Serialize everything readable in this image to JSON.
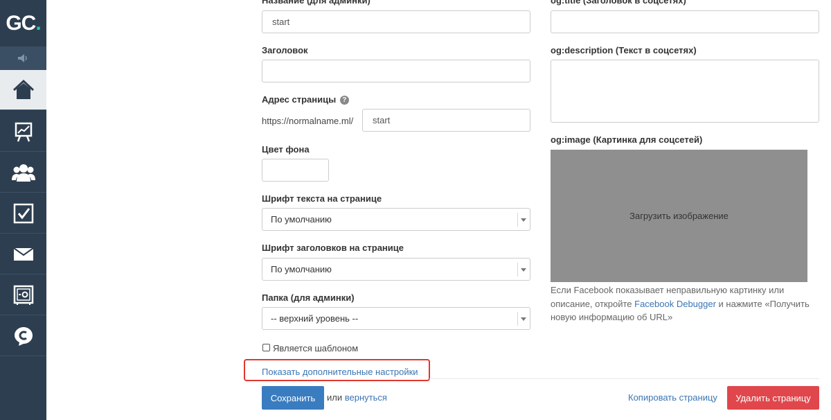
{
  "sidebar": {
    "logo": {
      "text_g": "G",
      "text_c": "C",
      "dot": "."
    },
    "sound_icon": "speaker-icon",
    "items": [
      {
        "name": "home",
        "icon": "home-icon",
        "active": true
      },
      {
        "name": "stats",
        "icon": "chart-easel-icon",
        "active": false
      },
      {
        "name": "users",
        "icon": "users-icon",
        "active": false
      },
      {
        "name": "tasks",
        "icon": "checkbox-icon",
        "active": false
      },
      {
        "name": "mail",
        "icon": "envelope-icon",
        "active": false
      },
      {
        "name": "safe",
        "icon": "safe-icon",
        "active": false
      },
      {
        "name": "chat",
        "icon": "chat-bubble-icon",
        "active": false
      }
    ]
  },
  "form": {
    "admin_name": {
      "label": "Название (для админки)",
      "value": "start"
    },
    "heading": {
      "label": "Заголовок",
      "value": ""
    },
    "page_address": {
      "label": "Адрес страницы",
      "prefix": "https://normalname.ml/",
      "value": "start",
      "help": "?"
    },
    "bg_color": {
      "label": "Цвет фона",
      "value": ""
    },
    "text_font": {
      "label": "Шрифт текста на странице",
      "value": "По умолчанию"
    },
    "heading_font": {
      "label": "Шрифт заголовков на странице",
      "value": "По умолчанию"
    },
    "folder": {
      "label": "Папка (для админки)",
      "value": "-- верхний уровень --"
    },
    "is_template": {
      "label": "Является шаблоном",
      "checked": false
    },
    "show_more": "Показать дополнительные настройки"
  },
  "social": {
    "og_title": {
      "label": "og:title (Заголовок в соцсетях)",
      "value": ""
    },
    "og_description": {
      "label": "og:description (Текст в соцсетях)",
      "value": ""
    },
    "og_image": {
      "label": "og:image (Картинка для соцсетей)",
      "upload": "Загрузить изображение"
    },
    "hint": {
      "part1": "Если Facebook показывает неправильную картинку или описание, откройте ",
      "link": "Facebook Debugger",
      "part2": " и нажмите «Получить новую информацию об URL»"
    }
  },
  "actions": {
    "save": "Сохранить",
    "or": "или",
    "back": "вернуться",
    "copy": "Копировать страницу",
    "delete": "Удалить страницу"
  },
  "colors": {
    "sidebar_bg": "#2d3e50",
    "accent": "#1fc9a8",
    "primary_btn": "#3a7cc0",
    "danger_btn": "#e0474c",
    "link": "#3a75b4",
    "highlight": "#e0372e"
  }
}
